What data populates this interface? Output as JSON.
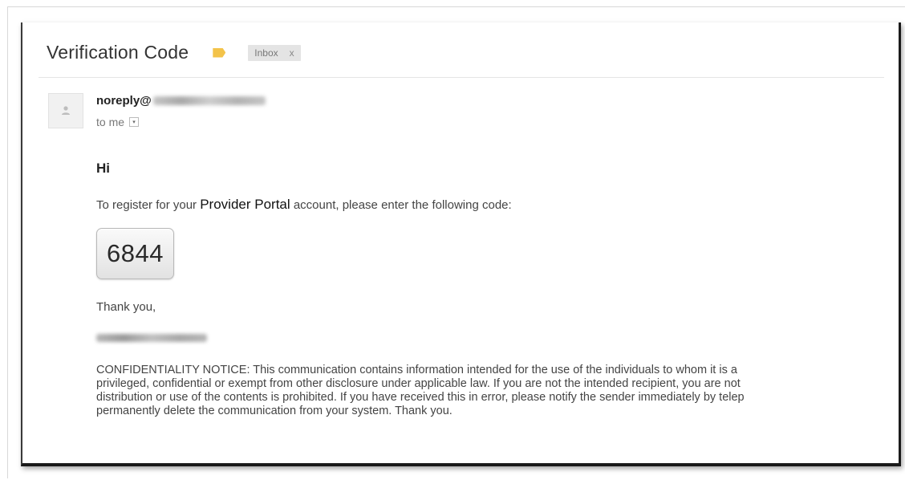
{
  "email": {
    "subject": "Verification Code",
    "label_color": "#f3c34a",
    "inbox_chip": {
      "label": "Inbox",
      "close": "x"
    },
    "sender": {
      "prefix": "noreply@",
      "recipient": "to me"
    },
    "greeting": "Hi",
    "intro": {
      "before": "To register for your ",
      "emphasis": "Provider Portal",
      "after": " account, please enter the following code:"
    },
    "code": "6844",
    "closing": "Thank you,",
    "notice_lines": [
      "CONFIDENTIALITY NOTICE: This communication contains information intended for the use of the individuals to whom it is a",
      "privileged, confidential or exempt from other disclosure under applicable law. If you are not the intended recipient, you are not",
      "distribution or use of the contents is prohibited. If you have received this in error, please notify the sender immediately by telep",
      "permanently delete the communication from your system. Thank you."
    ]
  },
  "icons": {
    "avatar": "person-silhouette-icon",
    "label": "label-tag-icon",
    "dropdown": "chevron-down-icon"
  }
}
